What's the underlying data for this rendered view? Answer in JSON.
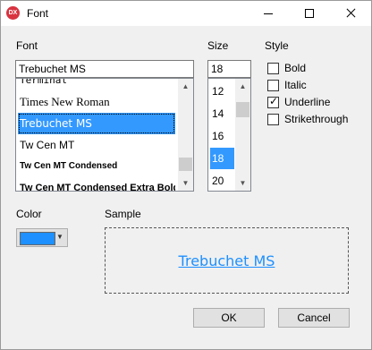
{
  "window": {
    "title": "Font",
    "app_icon_text": "DX"
  },
  "font": {
    "label": "Font",
    "value": "Trebuchet MS",
    "list": [
      {
        "label": "Terminal",
        "font": "\"DejaVu Sans Mono\", monospace",
        "size": "11px",
        "weight": "normal"
      },
      {
        "label": "Times New Roman",
        "font": "\"Liberation Serif\", serif",
        "size": "13px",
        "weight": "normal"
      },
      {
        "label": "Trebuchet MS",
        "font": "\"DejaVu Sans\", sans-serif",
        "size": "12px",
        "weight": "normal",
        "selected": true
      },
      {
        "label": "Tw Cen MT",
        "font": "\"Liberation Sans\", sans-serif",
        "size": "12px",
        "weight": "normal"
      },
      {
        "label": "Tw Cen MT Condensed",
        "font": "\"Liberation Sans\", sans-serif",
        "size": "10px",
        "weight": "bold"
      },
      {
        "label": "Tw Cen MT Condensed Extra Bold",
        "font": "\"Liberation Sans\", sans-serif",
        "size": "11px",
        "weight": "bold"
      }
    ]
  },
  "size": {
    "label": "Size",
    "value": "18",
    "list": [
      {
        "label": "12"
      },
      {
        "label": "14"
      },
      {
        "label": "16"
      },
      {
        "label": "18",
        "selected": true
      },
      {
        "label": "20"
      }
    ]
  },
  "style": {
    "label": "Style",
    "options": [
      {
        "label": "Bold",
        "checked": false
      },
      {
        "label": "Italic",
        "checked": false
      },
      {
        "label": "Underline",
        "checked": true
      },
      {
        "label": "Strikethrough",
        "checked": false
      }
    ]
  },
  "color": {
    "label": "Color",
    "value": "#1e90ff"
  },
  "sample": {
    "label": "Sample",
    "text": "Trebuchet MS",
    "color": "#1e90ff"
  },
  "buttons": {
    "ok": "OK",
    "cancel": "Cancel"
  },
  "colors": {
    "selection": "#3399ff"
  }
}
